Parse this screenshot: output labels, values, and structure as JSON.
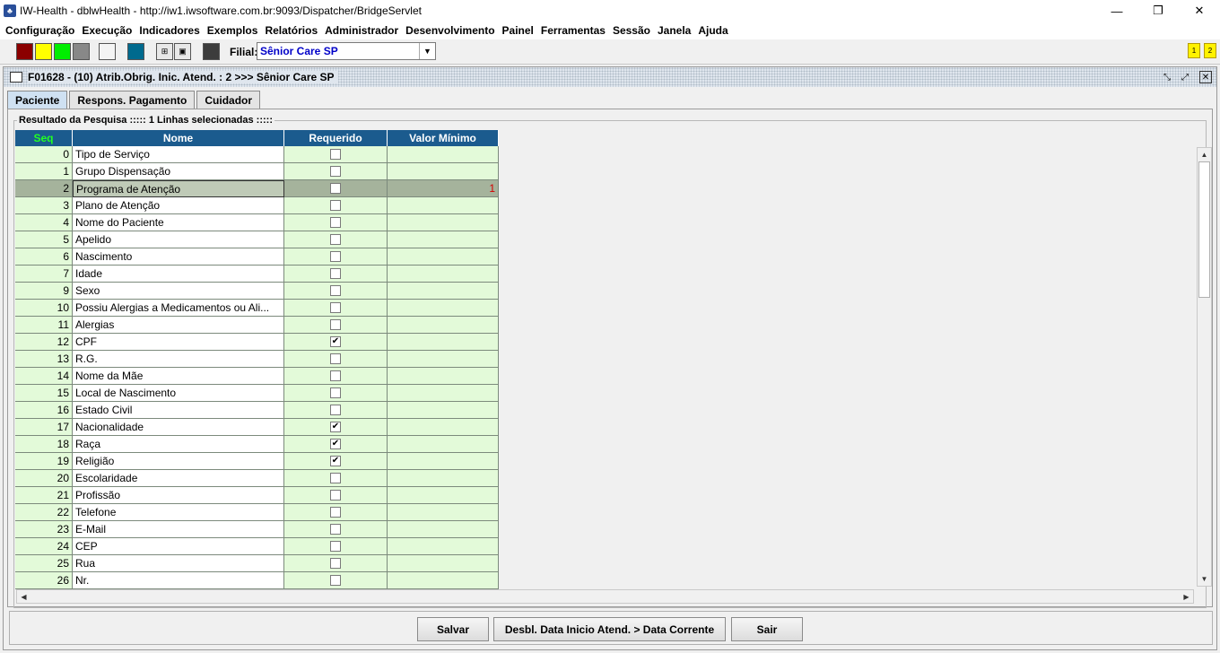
{
  "window": {
    "title": "IW-Health - dblwHealth - http://iw1.iwsoftware.com.br:9093/Dispatcher/BridgeServlet",
    "minimize": "—",
    "restore": "❐",
    "close": "✕"
  },
  "menu": [
    "Configuração",
    "Execução",
    "Indicadores",
    "Exemplos",
    "Relatórios",
    "Administrador",
    "Desenvolvimento",
    "Painel",
    "Ferramentas",
    "Sessão",
    "Janela",
    "Ajuda"
  ],
  "toolbar": {
    "colors": [
      "#8b0000",
      "#ffff00",
      "#00ee00",
      "#888888",
      "#f4f4f4",
      "#006a8e",
      "#3c3c3c"
    ],
    "filial_label": "Filial:",
    "filial_value": "Sênior Care SP",
    "badges": [
      "1",
      "2"
    ]
  },
  "frame": {
    "title": "F01628 - (10) Atrib.Obrig. Inic. Atend. : 2 >>> Sênior Care SP"
  },
  "tabs": [
    "Paciente",
    "Respons. Pagamento",
    "Cuidador"
  ],
  "active_tab": "Paciente",
  "group_label": "Resultado da Pesquisa ::::: 1 Linhas selecionadas :::::",
  "table": {
    "columns": [
      "Seq",
      "Nome",
      "Requerido",
      "Valor Mínimo"
    ],
    "rows": [
      {
        "seq": "0",
        "nome": "Tipo de Serviço",
        "req": false,
        "val": ""
      },
      {
        "seq": "1",
        "nome": "Grupo Dispensação",
        "req": false,
        "val": ""
      },
      {
        "seq": "2",
        "nome": "Programa de Atenção",
        "req": false,
        "val": "1",
        "selected": true
      },
      {
        "seq": "3",
        "nome": "Plano de Atenção",
        "req": false,
        "val": ""
      },
      {
        "seq": "4",
        "nome": "Nome do Paciente",
        "req": false,
        "val": ""
      },
      {
        "seq": "5",
        "nome": "Apelido",
        "req": false,
        "val": ""
      },
      {
        "seq": "6",
        "nome": "Nascimento",
        "req": false,
        "val": ""
      },
      {
        "seq": "7",
        "nome": "Idade",
        "req": false,
        "val": ""
      },
      {
        "seq": "9",
        "nome": "Sexo",
        "req": false,
        "val": ""
      },
      {
        "seq": "10",
        "nome": "Possiu Alergias a Medicamentos ou Ali...",
        "req": false,
        "val": ""
      },
      {
        "seq": "11",
        "nome": "Alergias",
        "req": false,
        "val": ""
      },
      {
        "seq": "12",
        "nome": "CPF",
        "req": true,
        "val": ""
      },
      {
        "seq": "13",
        "nome": "R.G.",
        "req": false,
        "val": ""
      },
      {
        "seq": "14",
        "nome": "Nome da Mãe",
        "req": false,
        "val": ""
      },
      {
        "seq": "15",
        "nome": "Local de Nascimento",
        "req": false,
        "val": ""
      },
      {
        "seq": "16",
        "nome": "Estado Civil",
        "req": false,
        "val": ""
      },
      {
        "seq": "17",
        "nome": "Nacionalidade",
        "req": true,
        "val": ""
      },
      {
        "seq": "18",
        "nome": "Raça",
        "req": true,
        "val": ""
      },
      {
        "seq": "19",
        "nome": "Religião",
        "req": true,
        "val": ""
      },
      {
        "seq": "20",
        "nome": "Escolaridade",
        "req": false,
        "val": ""
      },
      {
        "seq": "21",
        "nome": "Profissão",
        "req": false,
        "val": ""
      },
      {
        "seq": "22",
        "nome": "Telefone",
        "req": false,
        "val": ""
      },
      {
        "seq": "23",
        "nome": "E-Mail",
        "req": false,
        "val": ""
      },
      {
        "seq": "24",
        "nome": "CEP",
        "req": false,
        "val": ""
      },
      {
        "seq": "25",
        "nome": "Rua",
        "req": false,
        "val": ""
      },
      {
        "seq": "26",
        "nome": "Nr.",
        "req": false,
        "val": ""
      }
    ]
  },
  "buttons": {
    "save": "Salvar",
    "unlock": "Desbl. Data Inicio Atend. > Data Corrente",
    "exit": "Sair"
  }
}
